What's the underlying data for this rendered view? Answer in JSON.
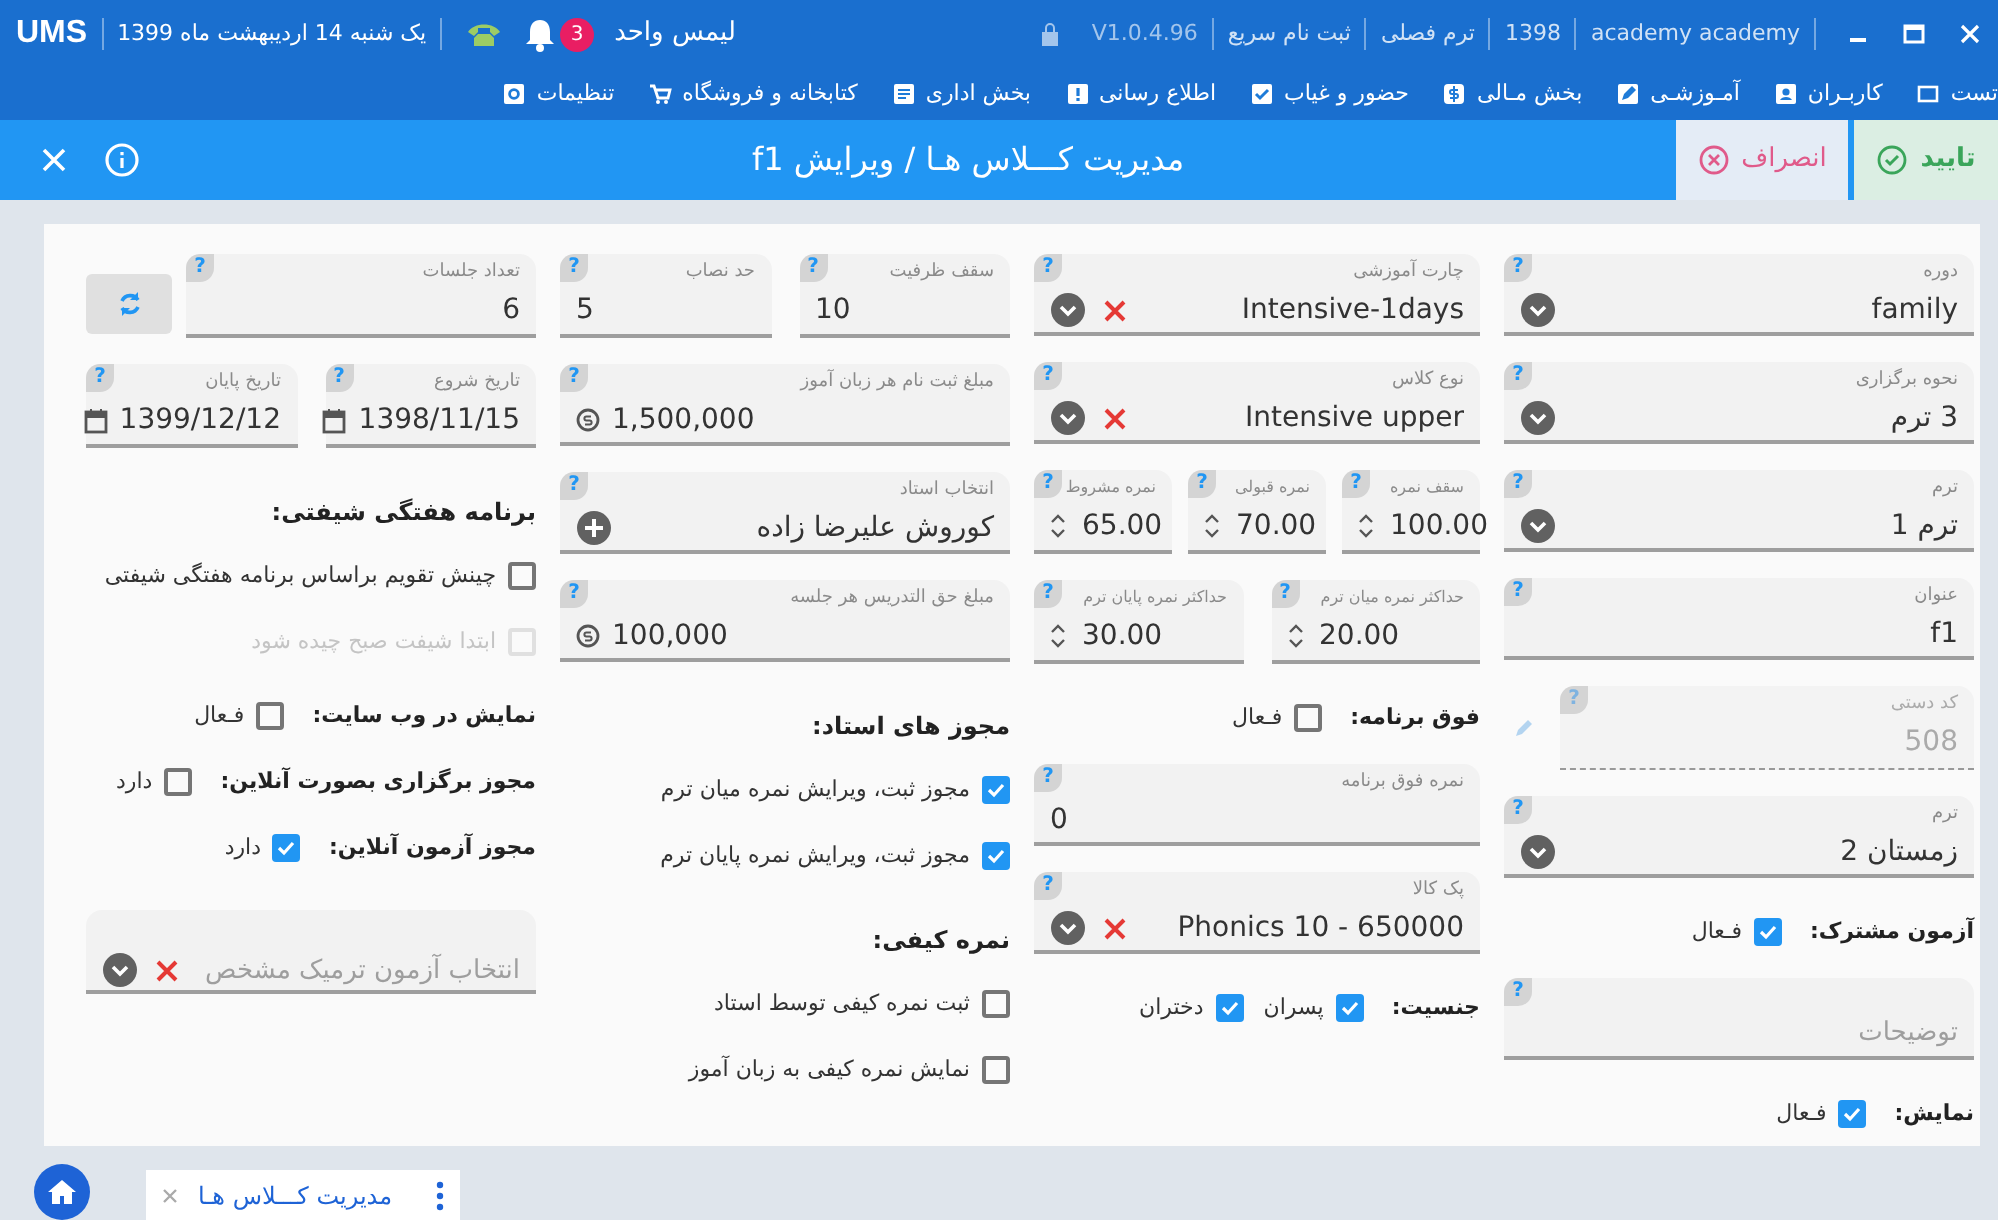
{
  "top_bar": {
    "logo": "UMS",
    "date": "یک شنبه 14 اردیبهشت ماه 1399",
    "notifications": "3",
    "branch": "لیمس واحد",
    "version": "V1.0.4.96",
    "quick_signup": "ثبت نام سریع",
    "term": "ترم فصلی",
    "year": "1398",
    "user": "academy academy"
  },
  "menu": [
    "تست",
    "کاربـران",
    "آمـوزشـی",
    "بخش مـالی",
    "حضور و غیاب",
    "اطلاع رسانی",
    "بخش اداری",
    "کتابخانه و فروشگاه",
    "تنظیمات"
  ],
  "title_bar": {
    "title": "مدیریت کـــلاس هـا / ویرایش f1",
    "confirm": "تایید",
    "cancel": "انصراف"
  },
  "form": {
    "columns": [
      [
        {
          "kind": "select",
          "label": "دوره",
          "value": "family",
          "clearable": false,
          "help": "?"
        },
        {
          "kind": "select",
          "label": "نحوه برگزاری",
          "value": "3 ترم",
          "clearable": false,
          "help": "?"
        },
        {
          "kind": "select",
          "label": "ترم",
          "value": "ترم 1",
          "clearable": false,
          "help": "?"
        },
        {
          "kind": "text",
          "label": "عنوان",
          "value": "f1",
          "help": "?"
        },
        {
          "kind": "locked",
          "label": "کد دستی",
          "value": "508",
          "help": "?"
        },
        {
          "kind": "select",
          "label": "ترم",
          "value": "زمستان 2",
          "clearable": false,
          "help": "?"
        },
        {
          "kind": "toggle",
          "label": "آزمون مشترک:",
          "options": [
            {
              "label": "فـعال",
              "checked": true
            }
          ]
        },
        {
          "kind": "text",
          "placeholder": "توضیحات",
          "help": "?"
        },
        {
          "kind": "toggle",
          "label": "نمایش:",
          "options": [
            {
              "label": "فـعال",
              "checked": true
            }
          ]
        }
      ],
      [
        {
          "kind": "select",
          "label": "چارت آموزشی",
          "value": "Intensive-1days",
          "clearable": true,
          "help": "?"
        },
        {
          "kind": "select",
          "label": "نوع کلاس",
          "value": "Intensive upper",
          "clearable": true,
          "help": "?"
        },
        {
          "kind": "group",
          "fields": [
            {
              "kind": "spinner",
              "label": "سقف نمره",
              "value": "100.00",
              "help": "?"
            },
            {
              "kind": "spinner",
              "label": "نمره قبولی",
              "value": "70.00",
              "help": "?"
            },
            {
              "kind": "spinner",
              "label": "نمره مشروط",
              "value": "65.00",
              "help": "?"
            }
          ]
        },
        {
          "kind": "group",
          "fields": [
            {
              "kind": "spinner",
              "label": "حداکثر نمره میان ترم",
              "value": "20.00",
              "help": "?"
            },
            {
              "kind": "spinner",
              "label": "حداکثر نمره پایان ترم",
              "value": "30.00",
              "help": "?"
            }
          ]
        },
        {
          "kind": "toggle",
          "label": "فوق برنامه:",
          "options": [
            {
              "label": "فـعال",
              "checked": false
            }
          ]
        },
        {
          "kind": "number",
          "label": "نمره فوق برنامه",
          "value": "0",
          "help": "?"
        },
        {
          "kind": "select",
          "label": "پک کالا",
          "value": "Phonics 10 - 650000",
          "clearable": true,
          "help": "?"
        },
        {
          "kind": "toggle",
          "label": "جنسیت:",
          "options": [
            {
              "label": "پسران",
              "checked": true
            },
            {
              "label": "دختران",
              "checked": true
            }
          ]
        }
      ],
      [
        {
          "kind": "group",
          "fields": [
            {
              "kind": "number",
              "label": "سقف ظرفیت",
              "value": "10",
              "help": "?"
            },
            {
              "kind": "number",
              "label": "حد نصاب",
              "value": "5",
              "help": "?"
            }
          ]
        },
        {
          "kind": "money",
          "label": "مبلغ ثبت نام هر زبان آموز",
          "value": "1,500,000",
          "help": "?"
        },
        {
          "kind": "teacher",
          "label": "انتخاب استاد",
          "value": "کوروش علیرضا زاده",
          "help": "?"
        },
        {
          "kind": "money",
          "label": "مبلغ حق التدریس هر جلسه",
          "value": "100,000",
          "help": "?"
        },
        {
          "kind": "heading",
          "text": "مجوز های استاد:"
        },
        {
          "kind": "checkbox",
          "label": "مجوز ثبت، ویرایش نمره میان ترم",
          "checked": true,
          "disabled": false
        },
        {
          "kind": "checkbox",
          "label": "مجوز ثبت، ویرایش نمره پایان ترم",
          "checked": true,
          "disabled": false
        },
        {
          "kind": "heading",
          "text": "نمره کیفی:"
        },
        {
          "kind": "checkbox",
          "label": "ثبت نمره کیفی توسط استاد",
          "checked": false,
          "disabled": false
        },
        {
          "kind": "checkbox",
          "label": "نمایش نمره کیفی به زبان آموز",
          "checked": false,
          "disabled": false
        }
      ],
      [
        {
          "kind": "group",
          "fields": [
            {
              "kind": "text",
              "label": "تعداد جلسات",
              "value": "6",
              "help": "?"
            },
            {
              "kind": "refresh"
            }
          ]
        },
        {
          "kind": "group",
          "fields": [
            {
              "kind": "date",
              "label": "تاریخ شروع",
              "value": "1398/11/15",
              "help": "?"
            },
            {
              "kind": "date",
              "label": "تاریخ پایان",
              "value": "1399/12/12",
              "help": "?"
            }
          ]
        },
        {
          "kind": "heading",
          "text": "برنامه هفتگی شیفتی:"
        },
        {
          "kind": "checkbox",
          "label": "چینش تقویم براساس برنامه هفتگی شیفتی",
          "checked": false,
          "disabled": false
        },
        {
          "kind": "checkbox",
          "label": "ابتدا شیفت صبح چیده شود",
          "checked": false,
          "disabled": true
        },
        {
          "kind": "toggle",
          "label": "نمایش در وب سایت:",
          "options": [
            {
              "label": "فـعال",
              "checked": false
            }
          ]
        },
        {
          "kind": "toggle",
          "label": "مجوز برگزاری بصورت آنلاین:",
          "options": [
            {
              "label": "دارد",
              "checked": false
            }
          ]
        },
        {
          "kind": "toggle",
          "label": "مجوز آزمون آنلاین:",
          "options": [
            {
              "label": "دارد",
              "checked": true
            }
          ]
        },
        {
          "kind": "select",
          "placeholder": "انتخاب آزمون ترمیک مشخص",
          "clearable": true
        }
      ]
    ]
  },
  "bottom_bar": {
    "tab": "مدیریت کـــلاس هـا"
  }
}
